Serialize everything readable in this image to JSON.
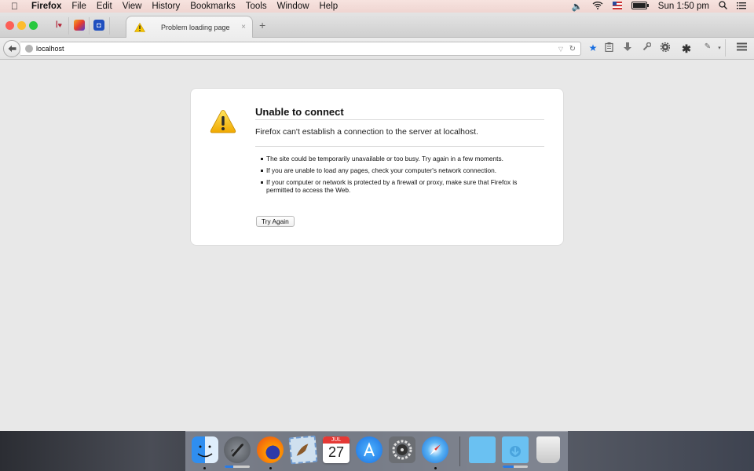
{
  "menubar": {
    "apple": "",
    "app_name": "Firefox",
    "items": [
      "File",
      "Edit",
      "View",
      "History",
      "Bookmarks",
      "Tools",
      "Window",
      "Help"
    ],
    "clock": "Sun 1:50 pm",
    "status_icons": [
      "volume-icon",
      "wifi-icon",
      "flag-icon",
      "battery-icon",
      "spotlight-icon",
      "notification-center-icon"
    ]
  },
  "browser": {
    "pinned_tabs": [
      "iheartradio",
      "app-2",
      "app-3"
    ],
    "tab": {
      "title": "Problem loading page",
      "close": "×"
    },
    "new_tab": "+",
    "url": "localhost",
    "toolbar_icons": [
      "bookmark-star-icon",
      "reading-list-icon",
      "download-icon",
      "wrench-icon",
      "gear-icon",
      "asterisk-icon",
      "extension-icon",
      "menu-icon"
    ]
  },
  "error_page": {
    "title": "Unable to connect",
    "description": "Firefox can't establish a connection to the server at localhost.",
    "bullets": [
      "The site could be temporarily unavailable or too busy. Try again in a few moments.",
      "If you are unable to load any pages, check your computer's network connection.",
      "If your computer or network is protected by a firewall or proxy, make sure that Firefox is permitted to access the Web."
    ],
    "button": "Try Again"
  },
  "dock": {
    "apps": [
      "Finder",
      "Launchpad",
      "Firefox",
      "Mail",
      "Calendar",
      "App Store",
      "System Preferences",
      "Safari"
    ],
    "calendar": {
      "month": "JUL",
      "day": "27"
    },
    "launchpad_progress": 0.35,
    "downloads_progress": 0.45,
    "folders": [
      "Documents",
      "Downloads",
      "Trash"
    ]
  }
}
